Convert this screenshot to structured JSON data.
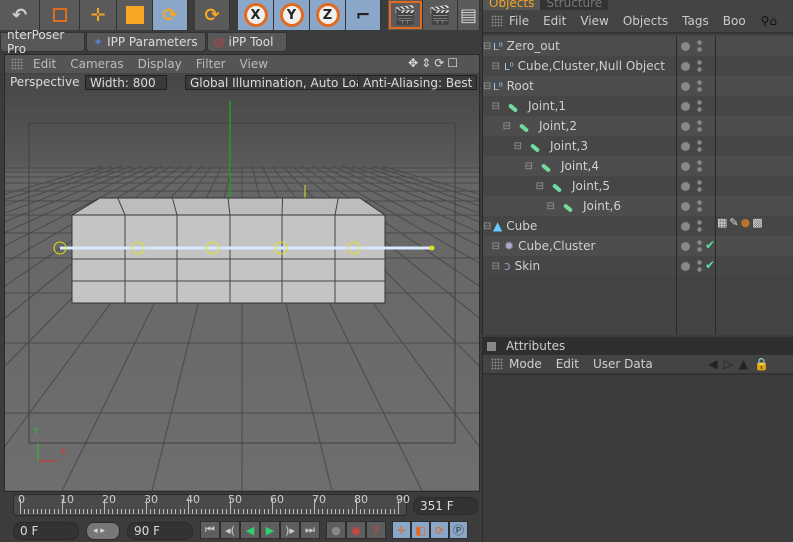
{
  "toolbar": {
    "axis_x": "X",
    "axis_y": "Y",
    "axis_z": "Z"
  },
  "plugin_tabs": [
    {
      "label": "nterPoser Pro"
    },
    {
      "label": "IPP Parameters"
    },
    {
      "label": "iPP Tool"
    }
  ],
  "viewport": {
    "menu": [
      "Edit",
      "Cameras",
      "Display",
      "Filter",
      "View"
    ],
    "camera": "Perspective",
    "width_label": "Width:  800",
    "gi_label": "Global Illumination, Auto Load",
    "aa_label": "Anti-Aliasing: Best",
    "axis_y": "Y",
    "axis_x": "X"
  },
  "timeline": {
    "ticks": [
      "0",
      "10",
      "20",
      "30",
      "40",
      "50",
      "60",
      "70",
      "80",
      "90"
    ],
    "end_frame": "351 F",
    "current": "0 F",
    "max": "90 F"
  },
  "objects_panel": {
    "tabs": [
      "Objects",
      "Structure"
    ],
    "menu": [
      "File",
      "Edit",
      "View",
      "Objects",
      "Tags",
      "Boo"
    ],
    "items": [
      {
        "name": "Zero_out",
        "indent": 0,
        "icon": "null-icon"
      },
      {
        "name": "Cube,Cluster,Null Object",
        "indent": 1,
        "icon": "null-icon"
      },
      {
        "name": "Root",
        "indent": 0,
        "icon": "null-icon"
      },
      {
        "name": "Joint,1",
        "indent": 1,
        "icon": "joint-icon"
      },
      {
        "name": "Joint,2",
        "indent": 2,
        "icon": "joint-icon"
      },
      {
        "name": "Joint,3",
        "indent": 3,
        "icon": "joint-icon"
      },
      {
        "name": "Joint,4",
        "indent": 4,
        "icon": "joint-icon"
      },
      {
        "name": "Joint,5",
        "indent": 5,
        "icon": "joint-icon"
      },
      {
        "name": "Joint,6",
        "indent": 6,
        "icon": "joint-icon"
      },
      {
        "name": "Cube",
        "indent": 0,
        "icon": "cube-icon"
      },
      {
        "name": "Cube,Cluster",
        "indent": 1,
        "icon": "cluster-icon",
        "check": "✔"
      },
      {
        "name": "Skin",
        "indent": 1,
        "icon": "skin-icon",
        "check": "✔"
      }
    ]
  },
  "attributes_panel": {
    "title": "Attributes",
    "menu": [
      "Mode",
      "Edit",
      "User Data"
    ]
  }
}
